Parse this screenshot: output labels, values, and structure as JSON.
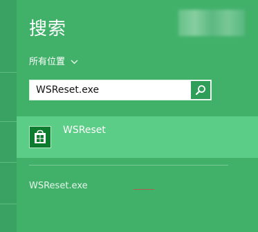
{
  "search_pane": {
    "title": "搜索",
    "scope_label": "所有位置",
    "scope_chevron_icon": "chevron-down-icon",
    "search_input": {
      "value": "WSReset.exe",
      "placeholder": ""
    },
    "search_button_icon": "magnifier-icon"
  },
  "results": [
    {
      "label": "WSReset",
      "icon": "store-tile-icon"
    }
  ],
  "suggestions": [
    {
      "label": "WSReset.exe"
    }
  ],
  "colors": {
    "charm_background": "#41b16a",
    "selected_result": "#5ccd86",
    "search_button": "#2f9e58",
    "app_tile": "#0e7c2f"
  }
}
